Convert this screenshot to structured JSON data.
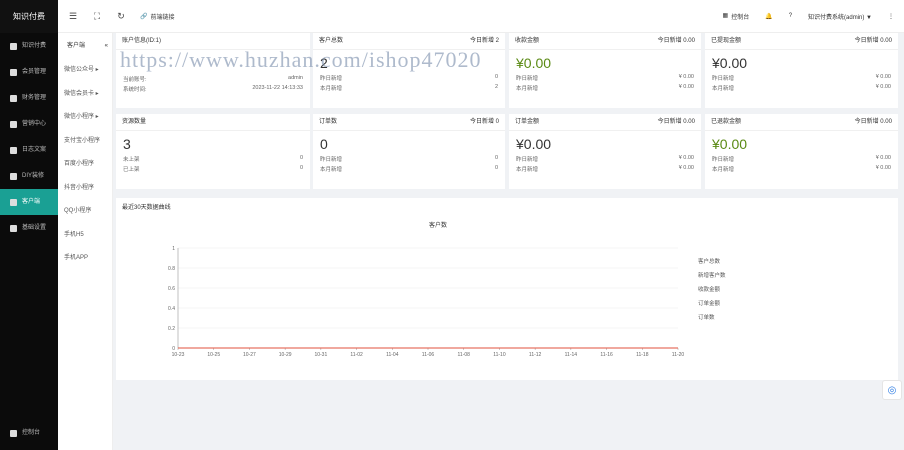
{
  "app": {
    "logo": "知识付费"
  },
  "topbar": {
    "refresh_icon": "refresh-icon",
    "link_label": "前端链接",
    "console_label": "控制台",
    "user_label": "知识付费系统(admin) ▼"
  },
  "sidebar": {
    "items": [
      {
        "label": "知识付费"
      },
      {
        "label": "会员管理"
      },
      {
        "label": "财务管理"
      },
      {
        "label": "营销中心"
      },
      {
        "label": "日志文案"
      },
      {
        "label": "DIY装修"
      },
      {
        "label": "客户端"
      },
      {
        "label": "基础设置"
      }
    ],
    "bottom_label": "控制台"
  },
  "subnav": {
    "head": "客户端",
    "collapse": "«",
    "items": [
      "微信公众号 ▸",
      "微信会员卡 ▸",
      "微信小程序 ▸",
      "支付宝小程序",
      "百度小程序",
      "抖音小程序",
      "QQ小程序",
      "手机H5",
      "手机APP"
    ]
  },
  "cards": {
    "account": {
      "title": "账户信息(ID:1)",
      "acc_label": "当前账号:",
      "acc_value": "admin",
      "time_label": "系统时间:",
      "time_value": "2023-11-22 14:13:33"
    },
    "customers": {
      "title": "客户总数",
      "today": "今日新增 2",
      "big": "2",
      "r1l": "昨日新增",
      "r1v": "0",
      "r2l": "本月新增",
      "r2v": "2"
    },
    "income": {
      "title": "收款金额",
      "today": "今日新增 0.00",
      "big": "¥0.00",
      "r1l": "昨日新增",
      "r1v": "¥ 0.00",
      "r2l": "本月新增",
      "r2v": "¥ 0.00"
    },
    "withdrawn": {
      "title": "已提现金额",
      "today": "今日新增 0.00",
      "big": "¥0.00",
      "r1l": "昨日新增",
      "r1v": "¥ 0.00",
      "r2l": "本月新增",
      "r2v": "¥ 0.00"
    },
    "resources": {
      "title": "资源数量",
      "big": "3",
      "r1l": "未上架",
      "r1v": "0",
      "r2l": "已上架",
      "r2v": "0"
    },
    "orders": {
      "title": "订单数",
      "today": "今日新增 0",
      "big": "0",
      "r1l": "昨日新增",
      "r1v": "0",
      "r2l": "本月新增",
      "r2v": "0"
    },
    "order_amount": {
      "title": "订单金额",
      "today": "今日新增 0.00",
      "big": "¥0.00",
      "r1l": "昨日新增",
      "r1v": "¥ 0.00",
      "r2l": "本月新增",
      "r2v": "¥ 0.00"
    },
    "refund": {
      "title": "已退款金额",
      "today": "今日新增 0.00",
      "big": "¥0.00",
      "r1l": "昨日新增",
      "r1v": "¥ 0.00",
      "r2l": "本月新增",
      "r2v": "¥ 0.00"
    }
  },
  "watermark": "https://www.huzhan.com/ishop47020",
  "chart_section_title": "最近30天数据曲线",
  "chart_data": {
    "type": "line",
    "title": "客户数",
    "x": [
      "10-23",
      "10-25",
      "10-27",
      "10-29",
      "10-31",
      "11-02",
      "11-04",
      "11-06",
      "11-08",
      "11-10",
      "11-12",
      "11-14",
      "11-16",
      "11-18",
      "11-20"
    ],
    "yticks": [
      "0",
      "0.2",
      "0.4",
      "0.6",
      "0.8",
      "1"
    ],
    "ylim": [
      0,
      1
    ],
    "series": [
      {
        "name": "客户总数",
        "values": [
          0,
          0,
          0,
          0,
          0,
          0,
          0,
          0,
          0,
          0,
          0,
          0,
          0,
          0,
          0
        ]
      },
      {
        "name": "新增客户数",
        "values": [
          0,
          0,
          0,
          0,
          0,
          0,
          0,
          0,
          0,
          0,
          0,
          0,
          0,
          0,
          0
        ]
      },
      {
        "name": "收款金额",
        "values": [
          0,
          0,
          0,
          0,
          0,
          0,
          0,
          0,
          0,
          0,
          0,
          0,
          0,
          0,
          0
        ]
      },
      {
        "name": "订单金额",
        "values": [
          0,
          0,
          0,
          0,
          0,
          0,
          0,
          0,
          0,
          0,
          0,
          0,
          0,
          0,
          0
        ]
      },
      {
        "name": "订单数",
        "values": [
          0,
          0,
          0,
          0,
          0,
          0,
          0,
          0,
          0,
          0,
          0,
          0,
          0,
          0,
          0
        ]
      }
    ],
    "line_color": "#e0503c",
    "legend_position": "right"
  }
}
